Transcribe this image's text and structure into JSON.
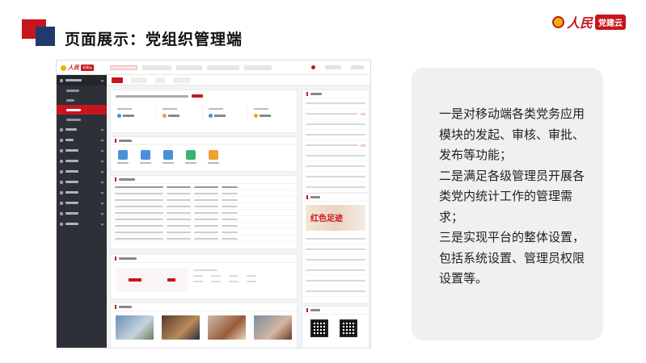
{
  "slide": {
    "title": "页面展示：党组织管理端",
    "brand": {
      "logo_text": "人民",
      "tag_text": "党建云"
    }
  },
  "description": [
    "一是对移动端各类党务应用模块的发起、审核、审批、发布等功能；",
    "二是满足各级管理员开展各类党内统计工作的管理需求；",
    "三是实现平台的整体设置，包括系统设置、管理员权限设置等。"
  ],
  "screenshot": {
    "banner_text": "红色足迹",
    "colors": {
      "accent": "#c8151d",
      "sidebar": "#2d3137",
      "navy": "#1f3a6b"
    },
    "app_icon_colors": [
      "#4a90d9",
      "#4a90d9",
      "#4a90d9",
      "#3cb371",
      "#f0a030"
    ],
    "stat_icon_colors": [
      "#4a90d9",
      "#f0a030",
      "#4a90d9",
      "#f0a030"
    ]
  }
}
